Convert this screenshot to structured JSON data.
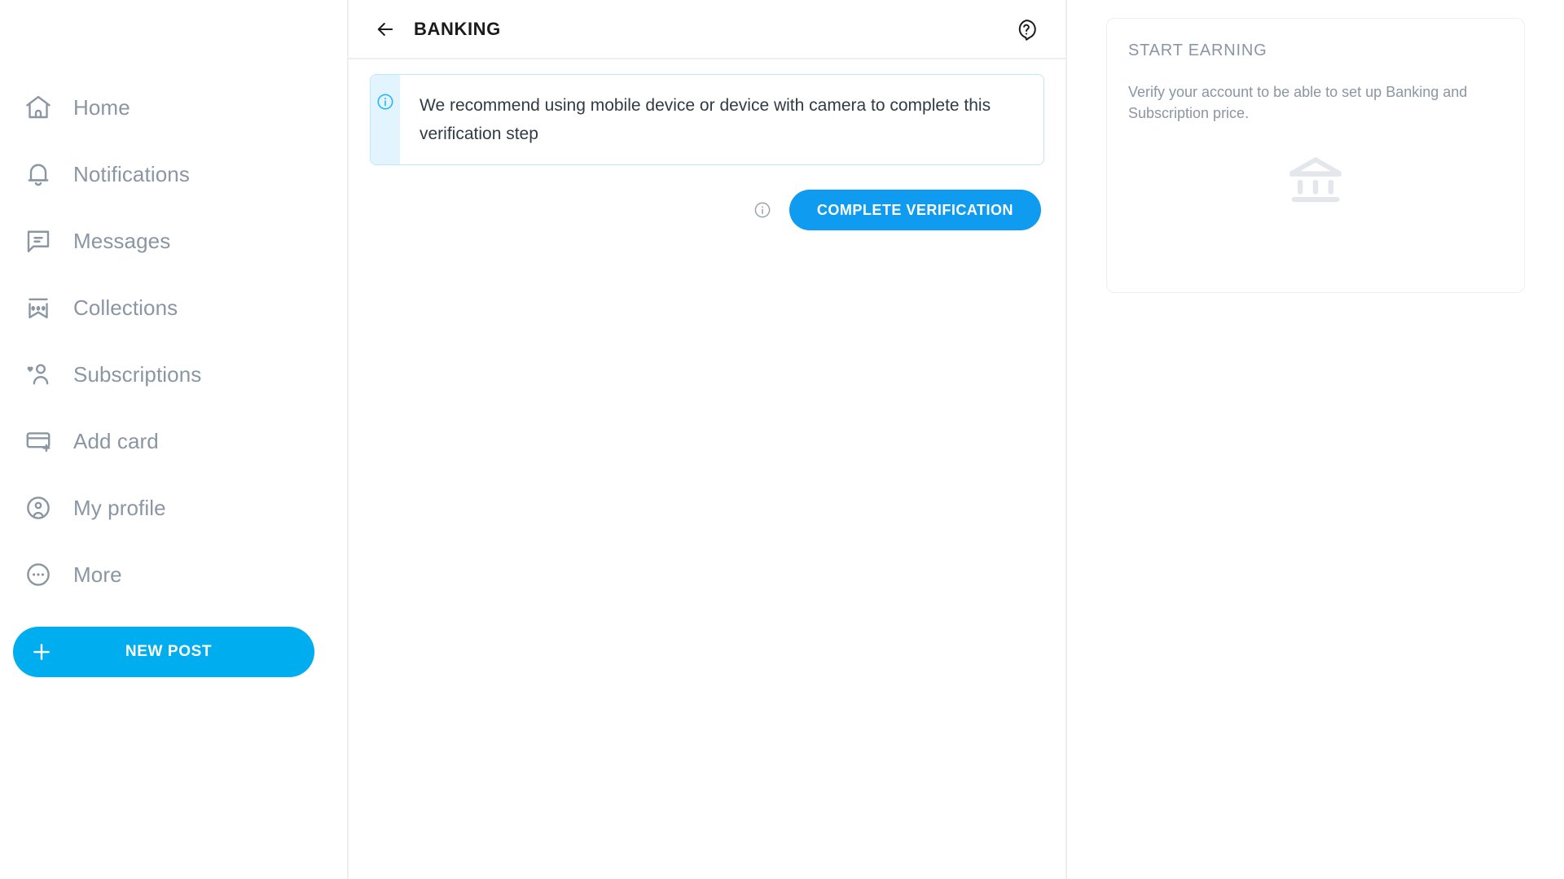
{
  "sidebar": {
    "items": [
      {
        "label": "Home",
        "icon": "home-icon"
      },
      {
        "label": "Notifications",
        "icon": "bell-icon"
      },
      {
        "label": "Messages",
        "icon": "message-icon"
      },
      {
        "label": "Collections",
        "icon": "bookmark-stars-icon"
      },
      {
        "label": "Subscriptions",
        "icon": "user-heart-icon"
      },
      {
        "label": "Add card",
        "icon": "credit-card-plus-icon"
      },
      {
        "label": "My profile",
        "icon": "user-circle-icon"
      },
      {
        "label": "More",
        "icon": "ellipsis-circle-icon"
      }
    ],
    "new_post_label": "NEW POST",
    "new_post_icon": "plus-icon"
  },
  "main": {
    "back_icon": "arrow-left-icon",
    "title": "BANKING",
    "help_icon": "help-question-icon",
    "banner": {
      "icon": "info-circle-icon",
      "text": "We recommend using mobile device or device with camera to complete this verification step"
    },
    "action": {
      "info_icon": "info-circle-outline-icon",
      "button_label": "COMPLETE VERIFICATION"
    }
  },
  "right_panel": {
    "card": {
      "title": "START EARNING",
      "description": "Verify your account to be able to set up Banking and Subscription price.",
      "illustration_icon": "bank-building-icon"
    }
  },
  "colors": {
    "accent": "#00aeef",
    "button_blue": "#0f9bef",
    "muted_text": "#8a96a3",
    "title_text": "#1b1b1b",
    "divider": "#eceef0",
    "banner_border": "#bfe6fa",
    "banner_strip": "#e2f4fd",
    "illustration": "#e3e7eb"
  }
}
